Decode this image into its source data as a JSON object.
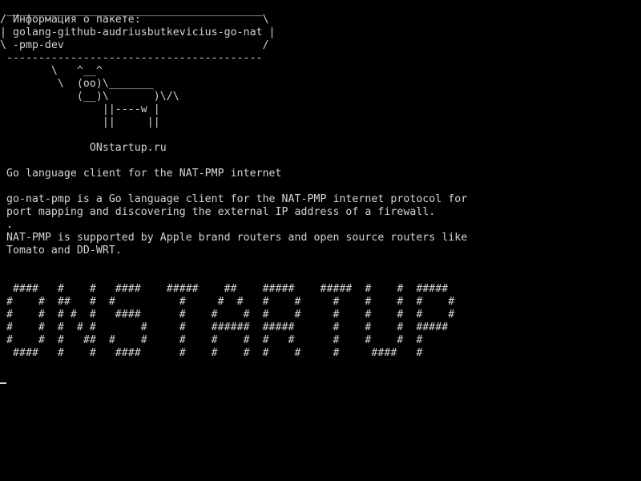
{
  "terminal": {
    "lines": [
      " ________________________________________",
      "/ Информация о пакете:                   \\",
      "| golang-github-audriusbutkevicius-go-nat |",
      "\\ -pmp-dev                               /",
      " ----------------------------------------",
      "        \\   ^__^",
      "         \\  (oo)\\_______",
      "            (__)\\       )\\/\\",
      "                ||----w |",
      "                ||     ||",
      "",
      "              ONstartup.ru",
      "",
      " Go language client for the NAT-PMP internet",
      "",
      " go-nat-pmp is a Go language client for the NAT-PMP internet protocol for",
      " port mapping and discovering the external IP address of a firewall.",
      " .",
      " NAT-PMP is supported by Apple brand routers and open source routers like",
      " Tomato and DD-WRT.",
      "",
      "",
      "  ####   #    #   ####    #####    ##    #####    #####  #    #  #####",
      " #    #  ##   #  #          #     #  #   #    #     #    #    #  #    #",
      " #    #  # #  #   ####      #    #    #  #    #     #    #    #  #    #",
      " #    #  #  # #       #     #    ######  #####      #    #    #  #####",
      " #    #  #   ##  #    #     #    #    #  #   #      #    #    #  #",
      "  ####   #    #   ####      #    #    #  #    #     #     ####   #"
    ],
    "cursor": "_"
  }
}
